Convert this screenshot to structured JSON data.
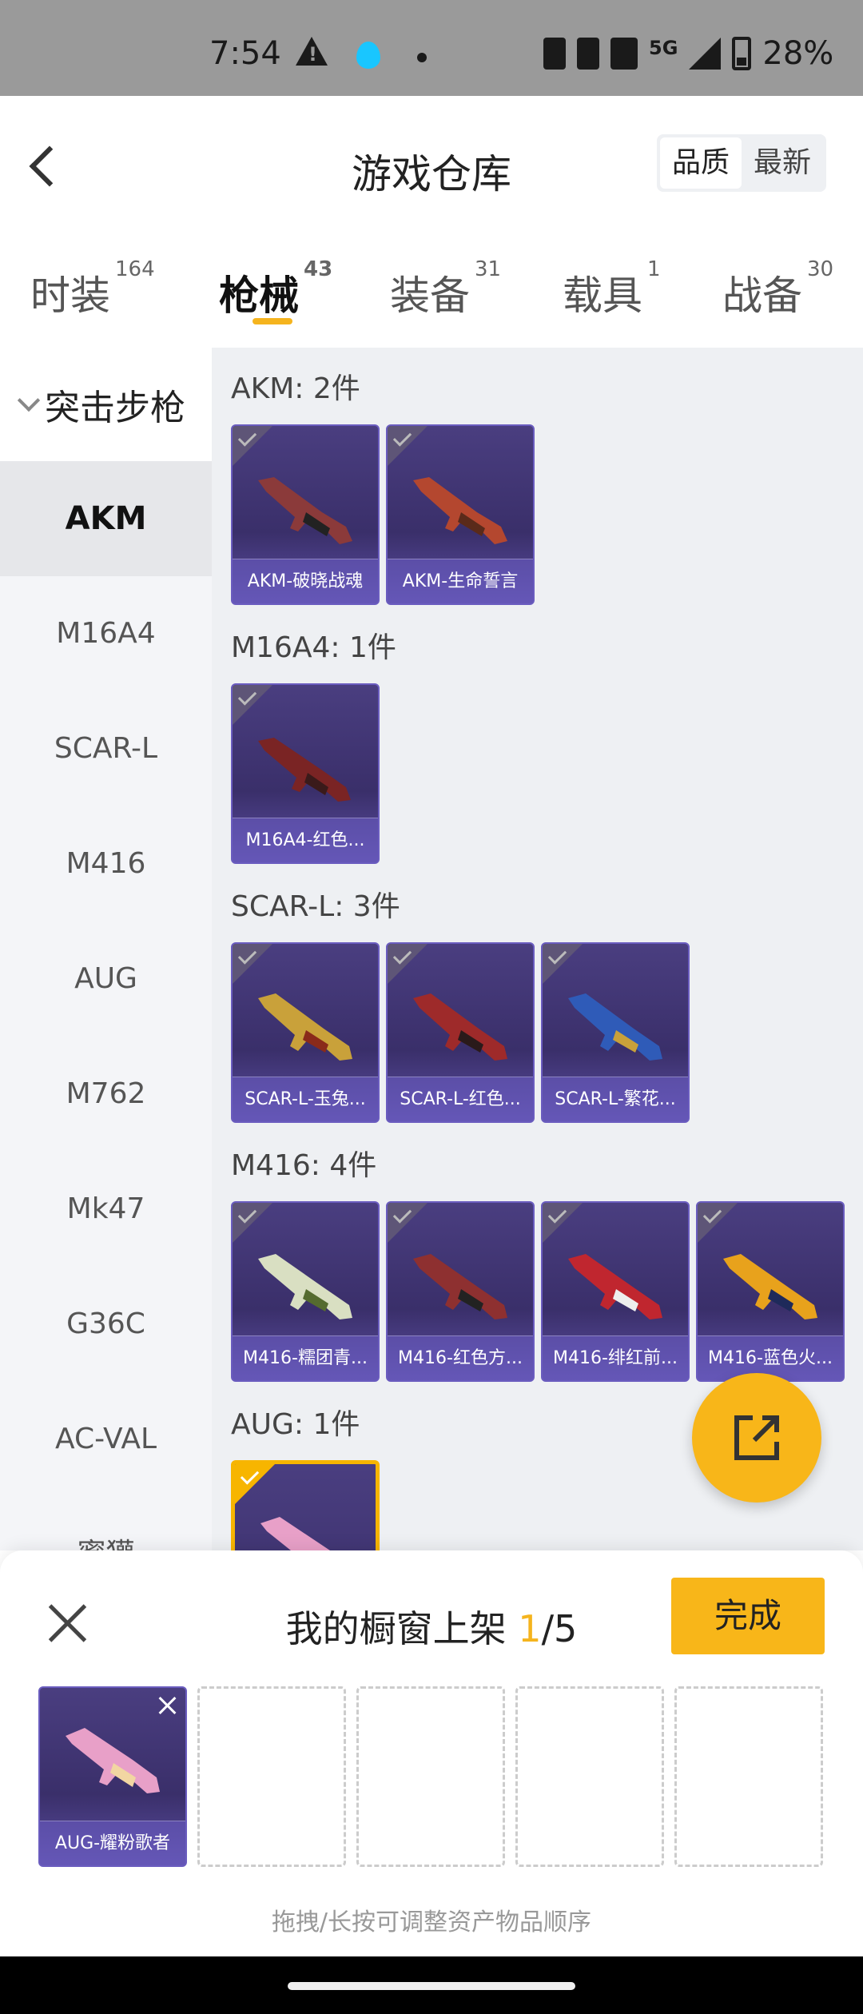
{
  "status_bar": {
    "time": "7:54",
    "network": "5G",
    "battery": "28%"
  },
  "header": {
    "title": "游戏仓库",
    "sort_options": [
      "品质",
      "最新"
    ]
  },
  "tabs": [
    {
      "label": "时装",
      "count": "164"
    },
    {
      "label": "枪械",
      "count": "43"
    },
    {
      "label": "装备",
      "count": "31"
    },
    {
      "label": "载具",
      "count": "1"
    },
    {
      "label": "战备",
      "count": "30"
    }
  ],
  "sidebar": {
    "group": "突击步枪",
    "items": [
      "AKM",
      "M16A4",
      "SCAR-L",
      "M416",
      "AUG",
      "M762",
      "Mk47",
      "G36C",
      "AC-VAL",
      "蜜獾"
    ]
  },
  "sections": [
    {
      "title": "AKM: 2件",
      "items": [
        "AKM-破晓战魂",
        "AKM-生命誓言"
      ]
    },
    {
      "title": "M16A4: 1件",
      "items": [
        "M16A4-红色..."
      ]
    },
    {
      "title": "SCAR-L: 3件",
      "items": [
        "SCAR-L-玉兔...",
        "SCAR-L-红色...",
        "SCAR-L-繁花..."
      ]
    },
    {
      "title": "M416: 4件",
      "items": [
        "M416-糯团青...",
        "M416-红色方...",
        "M416-绯红前...",
        "M416-蓝色火..."
      ]
    },
    {
      "title": "AUG: 1件",
      "items": [
        ""
      ]
    }
  ],
  "showcase": {
    "title_prefix": "我的橱窗上架 ",
    "count_current": "1",
    "count_total": "/5",
    "done_label": "完成",
    "slot_item": "AUG-耀粉歌者",
    "hint": "拖拽/长按可调整资产物品顺序"
  },
  "colors": {
    "accent": "#f8b619",
    "card_bg": "#3a2f6a",
    "card_border": "#6a5cbf"
  },
  "icons": {
    "back": "back-arrow-icon",
    "share": "share-icon",
    "close": "close-icon",
    "check": "check-icon"
  }
}
